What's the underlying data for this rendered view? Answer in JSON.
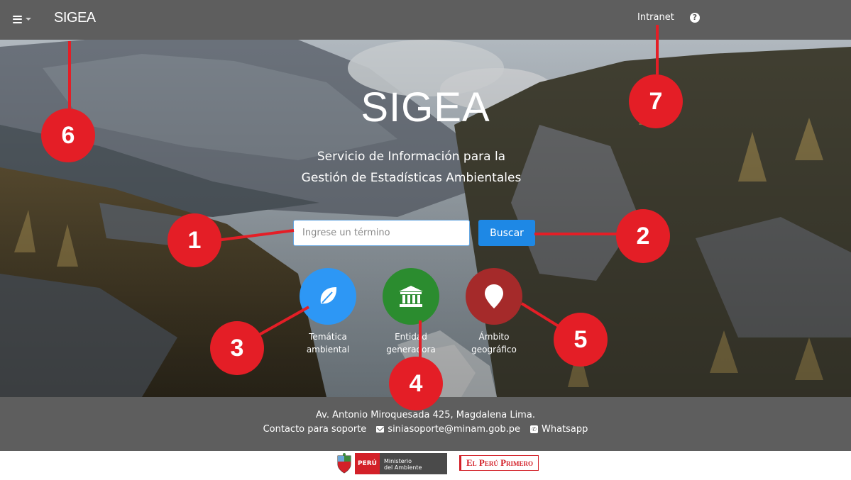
{
  "navbar": {
    "brand": "SIGEA",
    "links": [
      {
        "label": "Intranet"
      }
    ],
    "help_icon": "?"
  },
  "hero": {
    "title": "SIGEA",
    "subtitle_line1": "Servicio de Información para la",
    "subtitle_line2": "Gestión de Estadísticas Ambientales",
    "search": {
      "placeholder": "Ingrese un término",
      "value": ""
    },
    "search_button": "Buscar",
    "categories": [
      {
        "icon": "leaf-icon",
        "line1": "Temática",
        "line2": "ambiental",
        "color": "#2d97f5"
      },
      {
        "icon": "institution-icon",
        "line1": "Entidad",
        "line2": "generadora",
        "color": "#2b8c2f"
      },
      {
        "icon": "map-marker-icon",
        "line1": "Ámbito",
        "line2": "geográfico",
        "color": "#a52a2a"
      }
    ]
  },
  "callouts": [
    "1",
    "2",
    "3",
    "4",
    "5",
    "6",
    "7"
  ],
  "callout_color": "#e41e26",
  "footer": {
    "address": "Av. Antonio Miroquesada 425, Magdalena Lima.",
    "contact_label": "Contacto para soporte",
    "email": "siniasoporte@minam.gob.pe",
    "whatsapp": "Whatsapp"
  },
  "logos": {
    "peru": "PERÚ",
    "ministerio_line1": "Ministerio",
    "ministerio_line2": "del Ambiente",
    "primero": "El Perú Primero"
  },
  "colors": {
    "navbar": "#5e5e5e",
    "primary": "#1e88e5"
  }
}
